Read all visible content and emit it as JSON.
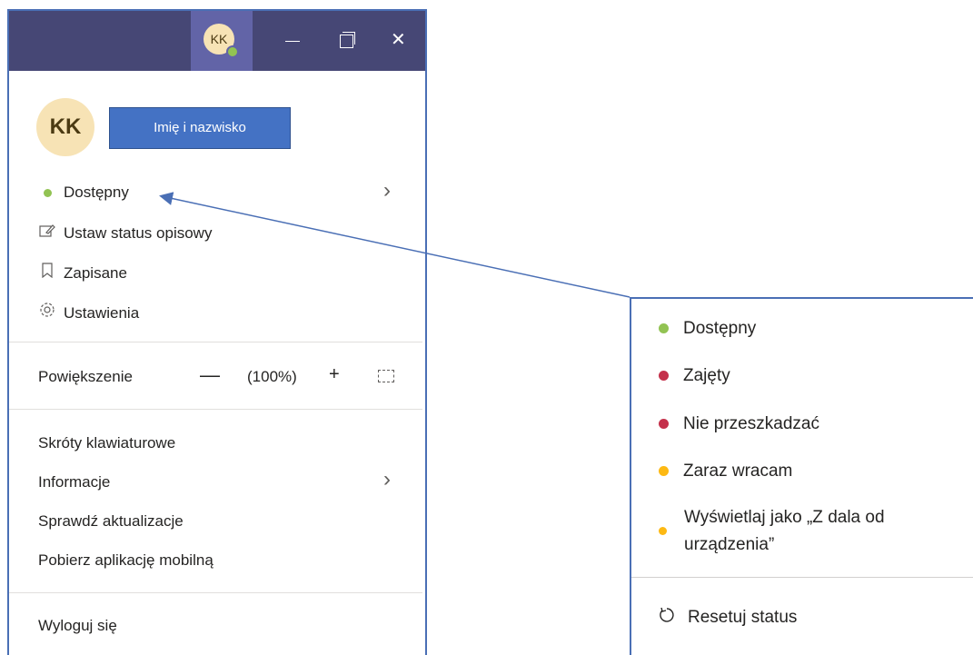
{
  "titlebar": {
    "avatar_initials": "KK",
    "minimize_glyph": "—",
    "close_glyph": "✕",
    "presence_color": "#92c353"
  },
  "profile": {
    "initials": "KK",
    "name_button": "Imię i nazwisko"
  },
  "menu": {
    "status_label": "Dostępny",
    "status_color": "#92c353",
    "set_status_message": "Ustaw status opisowy",
    "saved": "Zapisane",
    "settings": "Ustawienia",
    "zoom_label": "Powiększenie",
    "zoom_minus": "—",
    "zoom_value": "(100%)",
    "zoom_plus": "+",
    "keyboard_shortcuts": "Skróty klawiaturowe",
    "about": "Informacje",
    "check_updates": "Sprawdź aktualizacje",
    "get_mobile_app": "Pobierz aplikację mobilną",
    "sign_out": "Wyloguj się",
    "chevron": "›"
  },
  "status_popup": {
    "items": [
      {
        "label": "Dostępny",
        "color": "#92c353"
      },
      {
        "label": "Zajęty",
        "color": "#c4314b"
      },
      {
        "label": "Nie przeszkadzać",
        "color": "#c4314b"
      },
      {
        "label": "Zaraz wracam",
        "color": "#fdb913"
      },
      {
        "label_line1": "Wyświetlaj jako „Z dala od",
        "label_line2": "urządzenia”",
        "color": "#fdb913"
      }
    ],
    "reset_label": "Resetuj status"
  },
  "colors": {
    "titlebar": "#464775",
    "titlebar_active": "#6264a7",
    "name_button": "#4472c4",
    "annotation_border": "#4a6fb5"
  }
}
